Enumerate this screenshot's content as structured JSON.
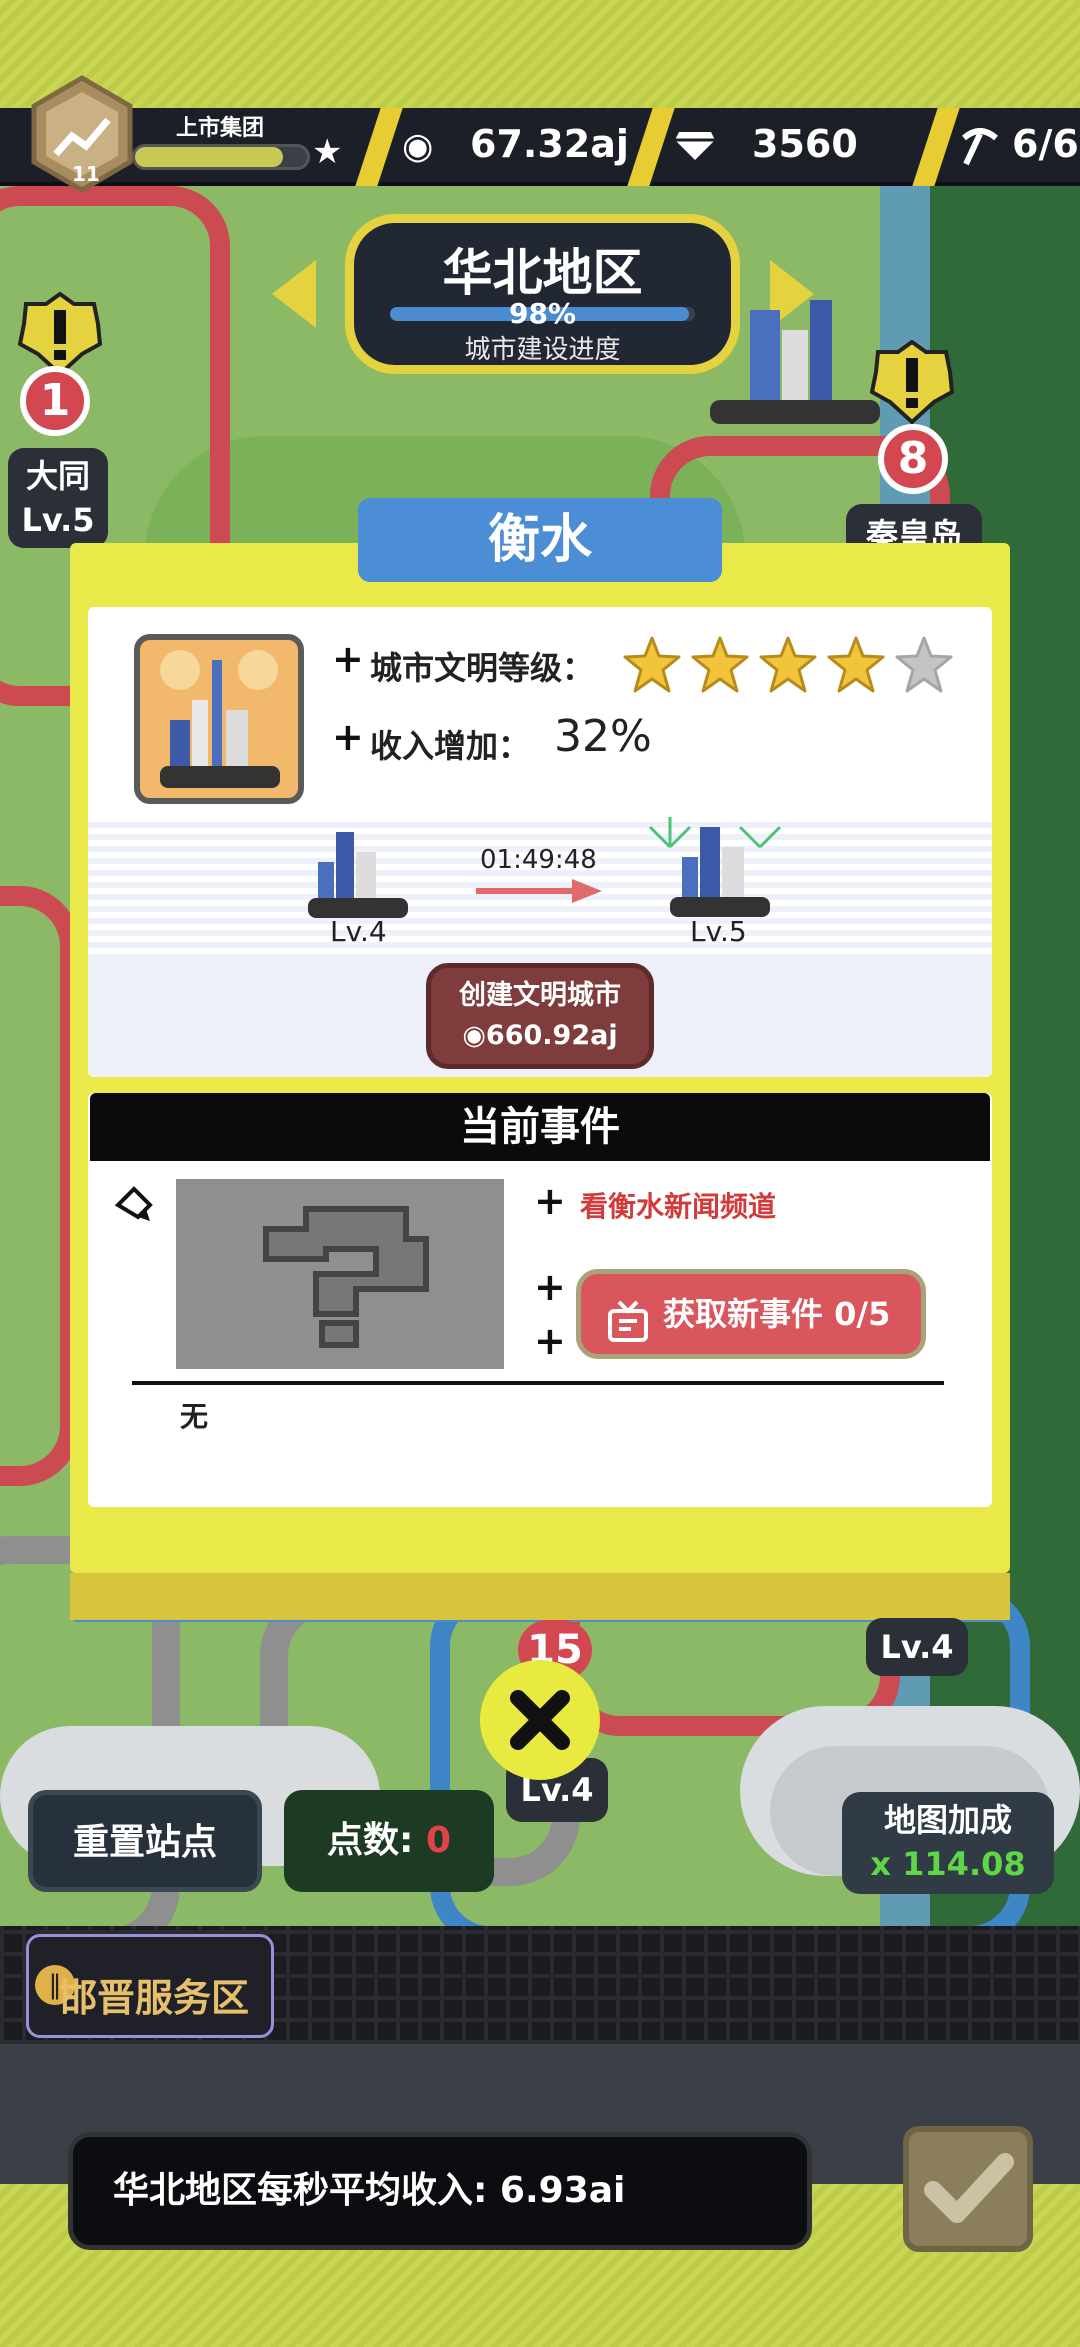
{
  "hud": {
    "company_level": "11",
    "company_title": "上市集团",
    "coins": "67.32aj",
    "gems": "3560",
    "workers": "6/6"
  },
  "region": {
    "name": "华北地区",
    "progress_pct": "98%",
    "progress_value": 0.98,
    "progress_label": "城市建设进度"
  },
  "map_cities": {
    "left_number": "1",
    "left_name": "大同",
    "left_level": "Lv.5",
    "right_number": "8",
    "right_name": "秦皇岛",
    "bottom_number": "15",
    "bottom_right_level": "Lv.4",
    "bottom_center_level": "Lv.4"
  },
  "modal": {
    "city_name": "衡水",
    "civ_level_label": "城市文明等级：",
    "civ_stars": 4,
    "civ_stars_max": 5,
    "income_label": "收入增加：",
    "income_value": "32%",
    "from_level": "Lv.4",
    "to_level": "Lv.5",
    "timer": "01:49:48",
    "build_button_line1": "创建文明城市",
    "build_button_line2": "◉660.92aj",
    "events_header": "当前事件",
    "watch_news": "看衡水新闻频道",
    "get_event_button": "获取新事件 0/5",
    "event_name": "无"
  },
  "bottom": {
    "reset_button": "重置站点",
    "points_label": "点数:",
    "points_value": "0",
    "map_bonus_label": "地图加成",
    "map_bonus_value": "x 114.08",
    "service_area": "邯晋服务区",
    "income_text": "华北地区每秒平均收入: 6.93ai"
  },
  "colors": {
    "accent_yellow": "#e9ea49",
    "modal_blue": "#4b8ed6",
    "red_button": "#c9545c",
    "bonus_green": "#5fd646"
  }
}
